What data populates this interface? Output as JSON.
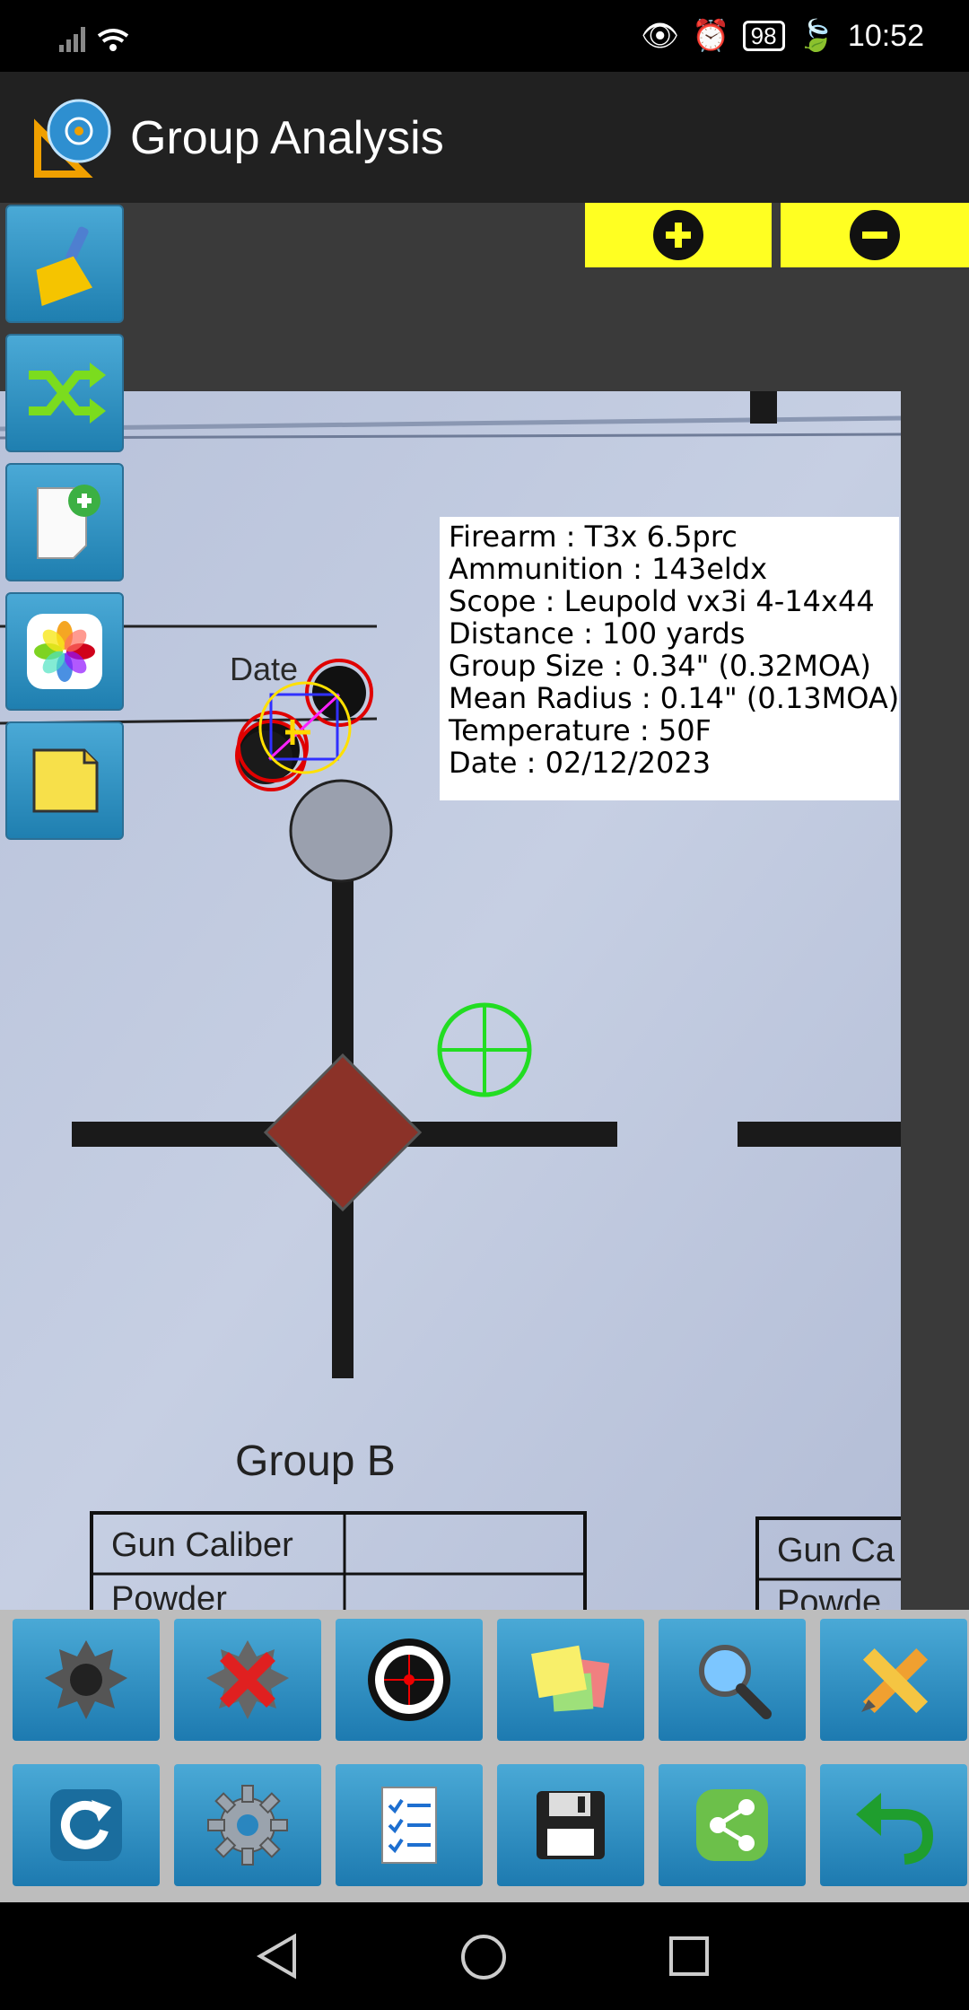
{
  "status_bar": {
    "battery": "98",
    "time": "10:52"
  },
  "app_bar": {
    "title": "Group Analysis"
  },
  "zoom": {
    "zoom_in_icon": "plus-circle-icon",
    "zoom_out_icon": "minus-circle-icon"
  },
  "side_tools": [
    {
      "name": "clear-button",
      "icon": "broom-icon"
    },
    {
      "name": "shuffle-button",
      "icon": "shuffle-icon"
    },
    {
      "name": "new-document-button",
      "icon": "add-document-icon"
    },
    {
      "name": "gallery-button",
      "icon": "photos-icon"
    },
    {
      "name": "note-button",
      "icon": "note-icon"
    }
  ],
  "target": {
    "labels": {
      "date": "Date",
      "group": "Group B",
      "gun_caliber": "Gun Caliber",
      "powder": "Powder",
      "gun_caliber_partial": "Gun Ca",
      "powder_partial": "Powde"
    }
  },
  "info": {
    "firearm": "Firearm : T3x 6.5prc",
    "ammunition": "Ammunition : 143eldx",
    "scope": "Scope : Leupold vx3i 4-14x44",
    "distance": "Distance : 100 yards",
    "group_size": "Group Size : 0.34\" (0.32MOA)",
    "mean_radius": "Mean Radius : 0.14\" (0.13MOA)",
    "temperature": "Temperature : 50F",
    "date": "Date : 02/12/2023"
  },
  "toolbar_row1": [
    {
      "name": "add-shot-button",
      "icon": "bullet-hole-icon"
    },
    {
      "name": "delete-shot-button",
      "icon": "delete-x-icon"
    },
    {
      "name": "target-button",
      "icon": "target-icon"
    },
    {
      "name": "sticky-notes-button",
      "icon": "sticky-notes-icon"
    },
    {
      "name": "zoom-button",
      "icon": "magnifier-icon"
    },
    {
      "name": "measure-button",
      "icon": "pencil-ruler-icon"
    }
  ],
  "toolbar_row2": [
    {
      "name": "refresh-button",
      "icon": "refresh-icon"
    },
    {
      "name": "settings-button",
      "icon": "gear-icon"
    },
    {
      "name": "report-button",
      "icon": "checklist-icon"
    },
    {
      "name": "save-button",
      "icon": "floppy-disk-icon"
    },
    {
      "name": "share-button",
      "icon": "share-icon"
    },
    {
      "name": "back-button",
      "icon": "undo-arrow-icon"
    }
  ],
  "colors": {
    "zoom_bg": "#ffff22",
    "shot_ring": "#e00000",
    "group_center": "#ffd800",
    "poa_marker": "#22dd22",
    "diamond": "#8b3228"
  }
}
